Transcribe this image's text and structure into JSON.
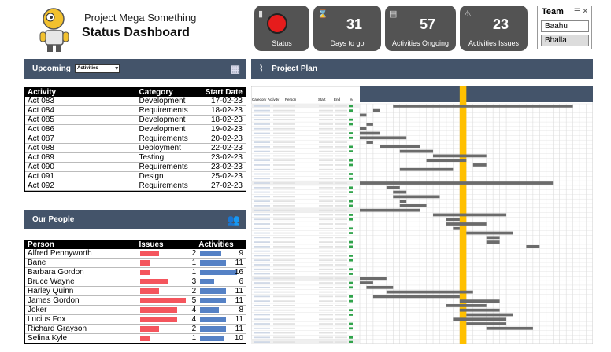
{
  "header": {
    "title": "Project Mega Something",
    "subtitle": "Status Dashboard"
  },
  "kpis": {
    "status": {
      "label": "Status",
      "color": "#e61c1c"
    },
    "days": {
      "value": "31",
      "label": "Days to go"
    },
    "ongoing": {
      "value": "57",
      "label": "Activities Ongoing"
    },
    "issues": {
      "value": "23",
      "label": "Activities Issues"
    }
  },
  "team": {
    "title": "Team",
    "options": [
      "Baahu",
      "Bhalla"
    ],
    "selected": "Bhalla"
  },
  "upcoming": {
    "title": "Upcoming",
    "select_value": "Activities",
    "columns": [
      "Activity",
      "Category",
      "Start Date"
    ],
    "rows": [
      [
        "Act 083",
        "Development",
        "17-02-23"
      ],
      [
        "Act 084",
        "Requirements",
        "18-02-23"
      ],
      [
        "Act 085",
        "Development",
        "18-02-23"
      ],
      [
        "Act 086",
        "Development",
        "19-02-23"
      ],
      [
        "Act 087",
        "Requirements",
        "20-02-23"
      ],
      [
        "Act 088",
        "Deployment",
        "22-02-23"
      ],
      [
        "Act 089",
        "Testing",
        "23-02-23"
      ],
      [
        "Act 090",
        "Requirements",
        "23-02-23"
      ],
      [
        "Act 091",
        "Design",
        "25-02-23"
      ],
      [
        "Act 092",
        "Requirements",
        "27-02-23"
      ]
    ]
  },
  "people": {
    "title": "Our People",
    "columns": [
      "Person",
      "Issues",
      "Activities"
    ],
    "rows": [
      {
        "name": "Alfred Pennyworth",
        "issues": 2,
        "activities": 9
      },
      {
        "name": "Bane",
        "issues": 1,
        "activities": 11
      },
      {
        "name": "Barbara Gordon",
        "issues": 1,
        "activities": 16
      },
      {
        "name": "Bruce Wayne",
        "issues": 3,
        "activities": 6
      },
      {
        "name": "Harley Quinn",
        "issues": 2,
        "activities": 11
      },
      {
        "name": "James Gordon",
        "issues": 5,
        "activities": 11
      },
      {
        "name": "Joker",
        "issues": 4,
        "activities": 8
      },
      {
        "name": "Lucius Fox",
        "issues": 4,
        "activities": 11
      },
      {
        "name": "Richard Grayson",
        "issues": 2,
        "activities": 11
      },
      {
        "name": "Selina Kyle",
        "issues": 1,
        "activities": 10
      }
    ]
  },
  "plan": {
    "title": "Project Plan",
    "columns": [
      "Category",
      "Activity",
      "Person",
      "Start",
      "End",
      "%"
    ]
  },
  "colors": {
    "accent": "#44546a",
    "kpi_bg": "#535353",
    "gantt_bar": "#6b6b6b",
    "today": "#ffc000",
    "issue_bar": "#f4555d",
    "activity_bar": "#5581c5"
  }
}
